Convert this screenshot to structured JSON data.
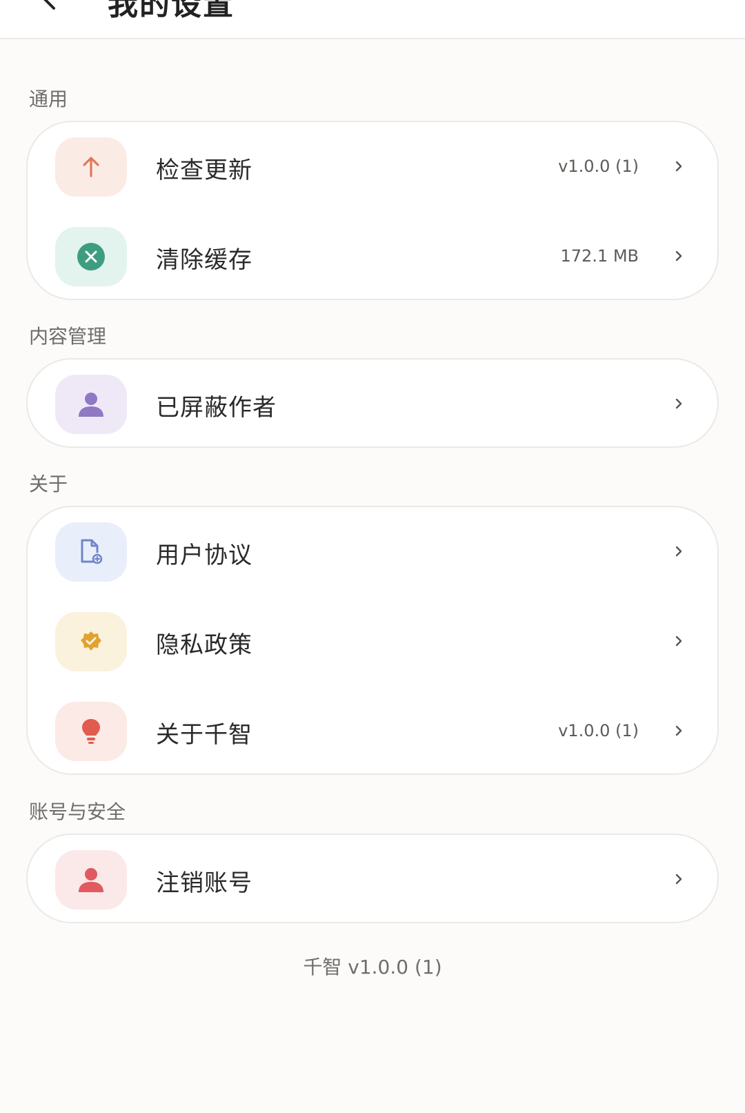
{
  "header": {
    "title": "我的设置"
  },
  "sections": [
    {
      "label": "通用",
      "items": [
        {
          "label": "检查更新",
          "value": "v1.0.0 (1)",
          "icon": "arrow-up-icon"
        },
        {
          "label": "清除缓存",
          "value": "172.1 MB",
          "icon": "close-circle-icon"
        }
      ]
    },
    {
      "label": "内容管理",
      "items": [
        {
          "label": "已屏蔽作者",
          "icon": "person-icon"
        }
      ]
    },
    {
      "label": "关于",
      "items": [
        {
          "label": "用户协议",
          "icon": "document-icon"
        },
        {
          "label": "隐私政策",
          "icon": "verified-badge-icon"
        },
        {
          "label": "关于千智",
          "value": "v1.0.0 (1)",
          "icon": "lightbulb-icon"
        }
      ]
    },
    {
      "label": "账号与安全",
      "items": [
        {
          "label": "注销账号",
          "icon": "person-icon"
        }
      ]
    }
  ],
  "footer": {
    "version": "千智 v1.0.0 (1)"
  },
  "colors": {
    "background": "#fcfbfa",
    "card_border": "#ebe8e5",
    "update_icon_bg": "#fbebe5",
    "update_icon": "#e0785a",
    "cache_icon_bg": "#e3f3ee",
    "cache_icon": "#3e9d80",
    "blocked_icon_bg": "#efe9f7",
    "blocked_icon": "#8f78c4",
    "agreement_icon_bg": "#e9eefb",
    "agreement_icon": "#6f87c8",
    "privacy_icon_bg": "#fbf2dd",
    "privacy_icon": "#e0a332",
    "about_icon_bg": "#fbeae6",
    "about_icon": "#e15c4f",
    "delete_icon_bg": "#fbe8e8",
    "delete_icon": "#e05a5f"
  }
}
